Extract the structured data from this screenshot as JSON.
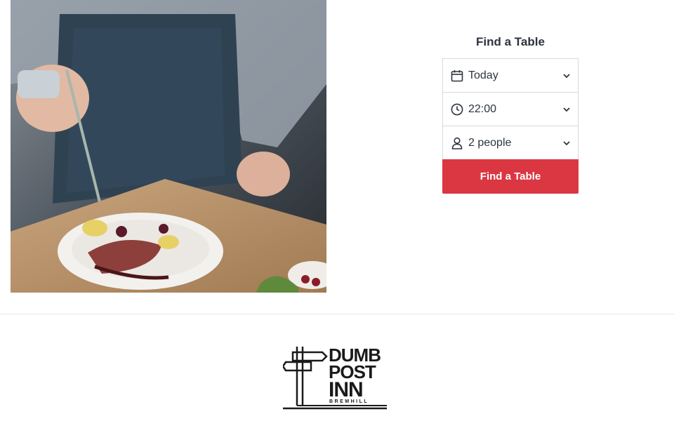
{
  "hero": {
    "image_alt": "Chef plating a dish"
  },
  "finder": {
    "title": "Find a Table",
    "date": {
      "value": "Today",
      "icon": "calendar-icon"
    },
    "time": {
      "value": "22:00",
      "icon": "clock-icon"
    },
    "party": {
      "value": "2 people",
      "icon": "person-icon"
    },
    "button_label": "Find a Table",
    "accent_color": "#da3743"
  },
  "footer": {
    "logo": {
      "line1": "DUMB",
      "line2": "POST",
      "line3": "INN",
      "subtitle": "BREMHILL"
    }
  }
}
